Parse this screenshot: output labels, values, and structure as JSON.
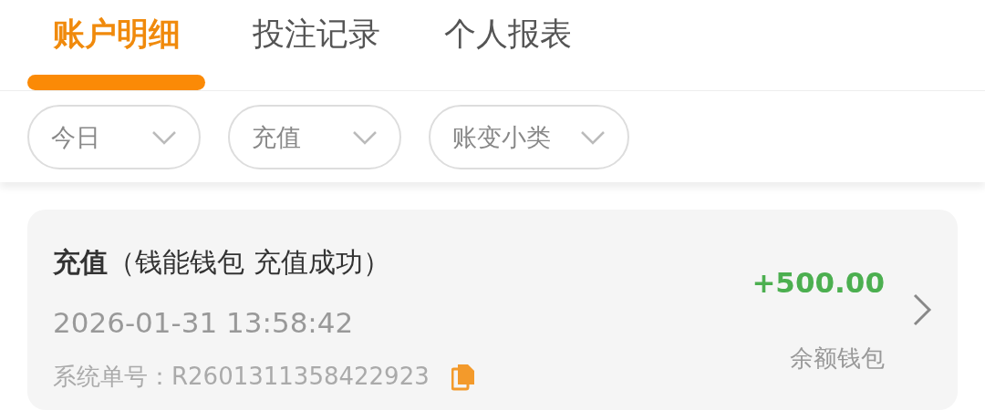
{
  "tabs": [
    {
      "label": "账户明细",
      "selected": true
    },
    {
      "label": "投注记录",
      "selected": false
    },
    {
      "label": "个人报表",
      "selected": false
    }
  ],
  "filters": [
    {
      "label": "今日"
    },
    {
      "label": "充值"
    },
    {
      "label": "账变小类"
    }
  ],
  "records": [
    {
      "title": "**充值**（钱能钱包 充值成功）",
      "time": "2026-01-31 13:58:42",
      "order_no": "系统单号：R2601311358422923",
      "amount": "+500.00",
      "kind": "credit",
      "wallet": "余额钱包"
    }
  ]
}
